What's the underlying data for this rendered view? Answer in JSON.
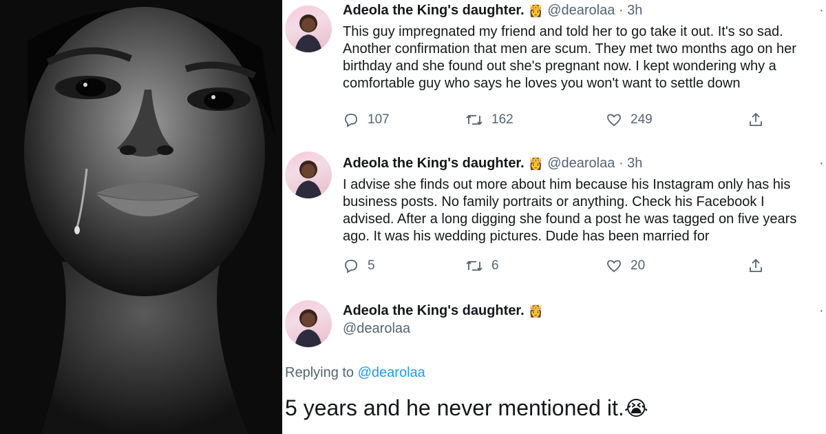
{
  "tweets": [
    {
      "author": "Adeola the King's daughter.",
      "badge_emoji": "👸",
      "handle": "@dearolaa",
      "separator": "·",
      "time": "3h",
      "lines": [
        "This guy impregnated my friend and told her to go take it out. It's so sad.",
        "Another confirmation that men are scum. They met two months ago on her",
        "birthday and she found out she's pregnant now. I kept wondering why a",
        "comfortable guy who says he loves you won't want to settle down"
      ],
      "replies": "107",
      "retweets": "162",
      "likes": "249"
    },
    {
      "author": "Adeola the King's daughter.",
      "badge_emoji": "👸",
      "handle": "@dearolaa",
      "separator": "·",
      "time": "3h",
      "lines": [
        "I advise she finds out more about him because his Instagram only has his",
        "business posts. No family portraits or anything. Check his Facebook I",
        "advised. After a long digging she found a post he was tagged on five years",
        "ago. It was his wedding pictures. Dude has been married for"
      ],
      "line4_emoji": "😭",
      "replies": "5",
      "retweets": "6",
      "likes": "20"
    }
  ],
  "detail": {
    "author": "Adeola the King's daughter.",
    "badge_emoji": "👸",
    "handle": "@dearolaa",
    "replying_prefix": "Replying to",
    "replying_to": "@dearolaa",
    "text": "5 years and he never mentioned it.",
    "text_emoji": "😭"
  },
  "icons": {
    "reply": "reply-icon",
    "retweet": "retweet-icon",
    "like": "heart-icon",
    "share": "share-icon",
    "more": "more-icon"
  },
  "colors": {
    "text": "#14171a",
    "muted": "#536471",
    "link": "#1d9bf0"
  }
}
